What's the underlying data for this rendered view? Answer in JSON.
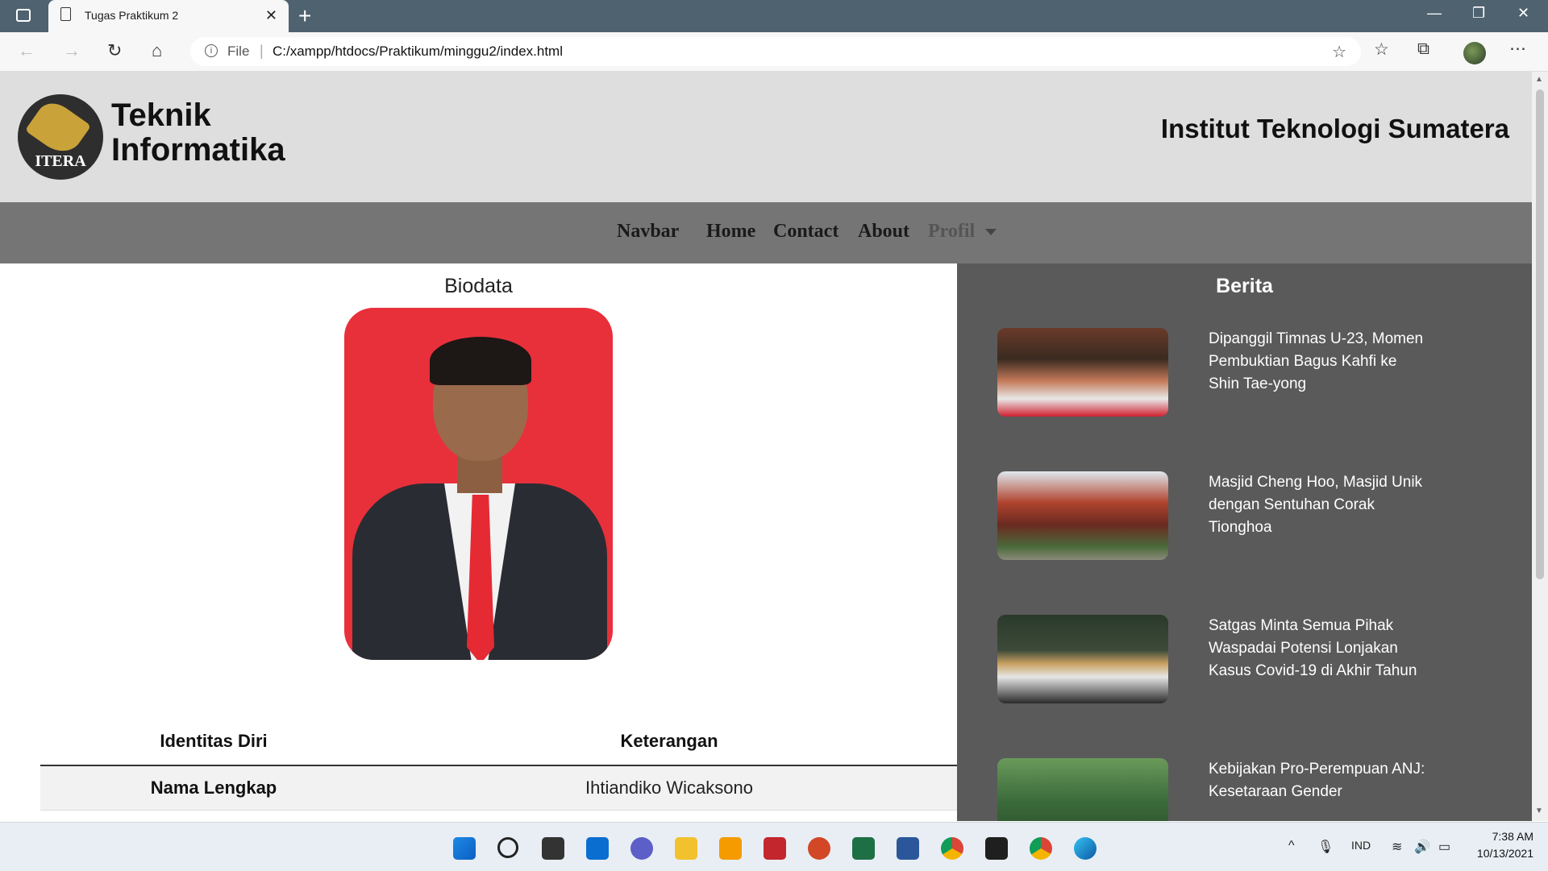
{
  "browser": {
    "tab_title": "Tugas Praktikum 2",
    "new_tab": "+",
    "address_prefix": "File",
    "address_url": "C:/xampp/htdocs/Praktikum/minggu2/index.html"
  },
  "header": {
    "logo_text": "ITERA",
    "brand_line1": "Teknik",
    "brand_line2": "Informatika",
    "institution": "Institut Teknologi Sumatera"
  },
  "nav": {
    "brand": "Navbar",
    "items": [
      "Home",
      "Contact",
      "About",
      "Profil"
    ]
  },
  "biodata": {
    "title": "Biodata",
    "table": {
      "headers": [
        "Identitas Diri",
        "Keterangan"
      ],
      "rows": [
        [
          "Nama Lengkap",
          "Ihtiandiko Wicaksono"
        ]
      ]
    }
  },
  "berita": {
    "title": "Berita",
    "items": [
      {
        "text": "Dipanggil Timnas U-23, Momen Pembuktian Bagus Kahfi ke Shin Tae-yong"
      },
      {
        "text": "Masjid Cheng Hoo, Masjid Unik dengan Sentuhan Corak Tionghoa"
      },
      {
        "text": "Satgas Minta Semua Pihak Waspadai Potensi Lonjakan Kasus Covid-19 di Akhir Tahun"
      },
      {
        "text": "Kebijakan Pro-Perempuan ANJ: Kesetaraan Gender"
      }
    ]
  },
  "taskbar": {
    "lang": "IND",
    "time": "7:38 AM",
    "date": "10/13/2021"
  }
}
